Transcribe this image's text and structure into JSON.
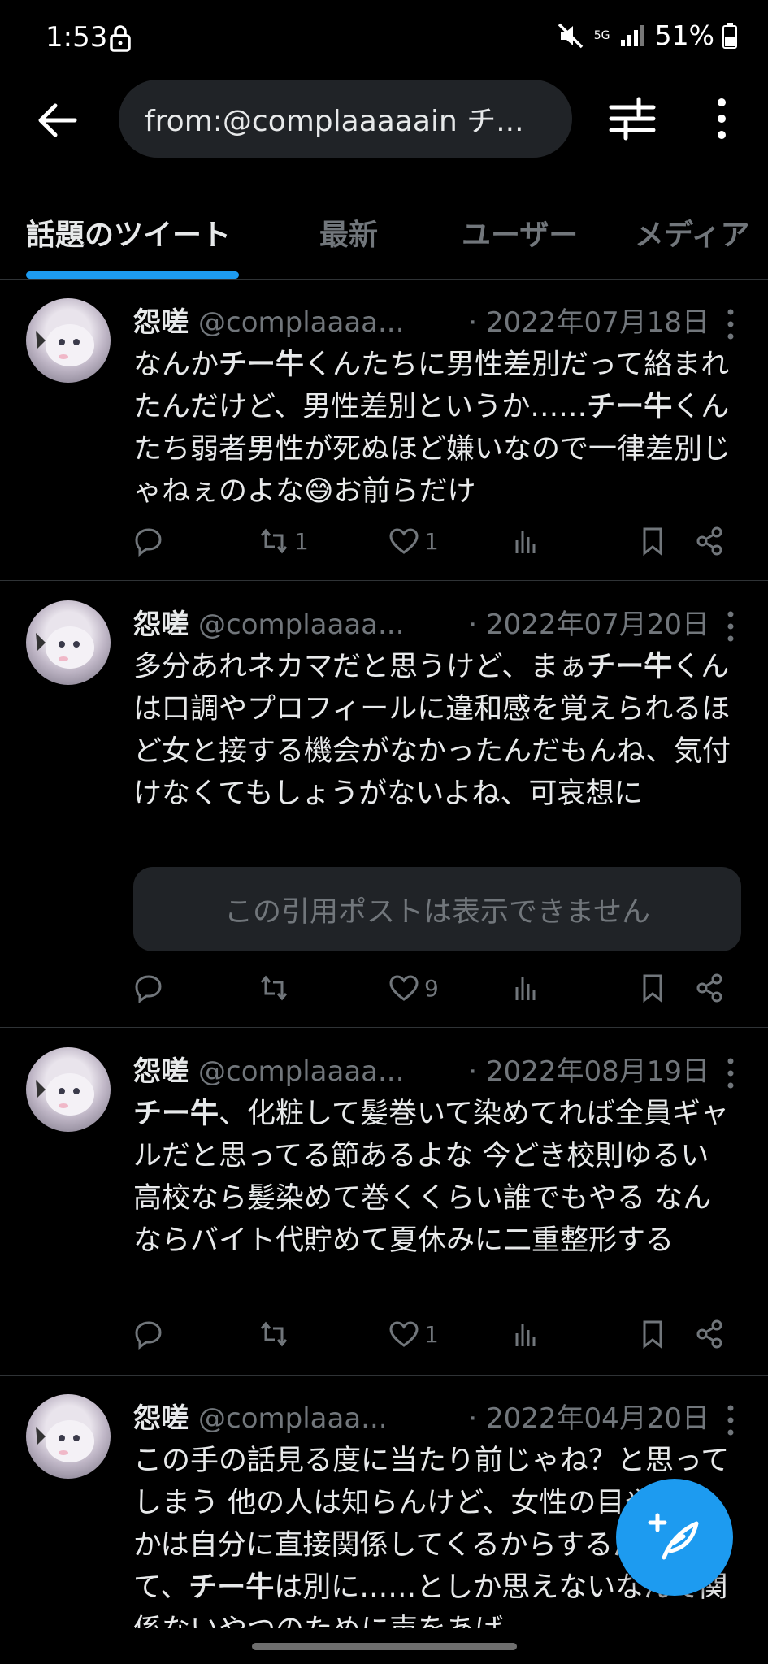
{
  "status_bar": {
    "time": "1:53",
    "network": "5G",
    "battery": "51%"
  },
  "search": {
    "query": "from:@complaaaaain チ..."
  },
  "tabs": [
    {
      "label": "話題のツイート"
    },
    {
      "label": "最新"
    },
    {
      "label": "ユーザー"
    },
    {
      "label": "メディア"
    }
  ],
  "tweets": [
    {
      "name": "怨嗟",
      "handle": "@complaaaa...",
      "date": "· 2022年07月18日",
      "text": "なんか<b>チー牛</b>くんたちに男性差別だって絡まれたんだけど、男性差別というか……<b>チー牛</b>くんたち弱者男性が死ぬほど嫌いなので一律差別じゃねぇのよな😅お前らだけ",
      "replies": "",
      "retweets": "1",
      "likes": "1"
    },
    {
      "name": "怨嗟",
      "handle": "@complaaaa...",
      "date": "· 2022年07月20日",
      "text": "多分あれネカマだと思うけど、まぁ<b>チー牛</b>くんは口調やプロフィールに違和感を覚えられるほど女と接する機会がなかったんだもんね、気付けなくてもしょうがないよね、可哀想に",
      "quote": "この引用ポストは表示できません",
      "replies": "",
      "retweets": "",
      "likes": "9"
    },
    {
      "name": "怨嗟",
      "handle": "@complaaaa...",
      "date": "· 2022年08月19日",
      "text": "<b>チー牛</b>、化粧して髪巻いて染めてれば全員ギャルだと思ってる節あるよな 今どき校則ゆるい高校なら髪染めて巻くくらい誰でもやる なんならバイト代貯めて夏休みに二重整形する",
      "replies": "",
      "retweets": "",
      "likes": "1"
    },
    {
      "name": "怨嗟",
      "handle": "@complaaa...",
      "date": "· 2022年04月20日",
      "text": "この手の話見る度に当たり前じゃね？と思ってしまう 他の人は知らんけど、女性の目やなんかは自分に直接関係してくるからするんであって、<b>チー牛</b>は別に……としか思えないなんで関係ないやつのために声をあげ",
      "replies": "",
      "retweets": "",
      "likes": ""
    }
  ],
  "colors": {
    "accent": "#1d9bf0",
    "background": "#000000",
    "muted": "#71767b"
  },
  "icons": [
    "back-arrow-icon",
    "filter-sliders-icon",
    "more-vertical-icon",
    "reply-icon",
    "retweet-icon",
    "like-icon",
    "views-icon",
    "bookmark-icon",
    "share-icon",
    "compose-icon"
  ]
}
